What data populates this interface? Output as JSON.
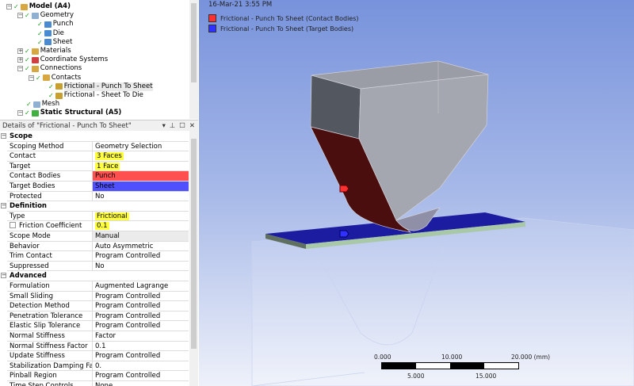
{
  "tree": {
    "items": [
      {
        "label": "Model (A4)",
        "bold": true,
        "level": 0,
        "exp": "−"
      },
      {
        "label": "Geometry",
        "level": 1,
        "exp": "−"
      },
      {
        "label": "Punch",
        "level": 2
      },
      {
        "label": "Die",
        "level": 2
      },
      {
        "label": "Sheet",
        "level": 2
      },
      {
        "label": "Materials",
        "level": 1,
        "exp": "+"
      },
      {
        "label": "Coordinate Systems",
        "level": 1,
        "exp": "+"
      },
      {
        "label": "Connections",
        "level": 1,
        "exp": "−"
      },
      {
        "label": "Contacts",
        "level": 2,
        "exp": "−"
      },
      {
        "label": "Frictional - Punch To Sheet",
        "level": 3,
        "selected": true
      },
      {
        "label": "Frictional - Sheet To Die",
        "level": 3
      },
      {
        "label": "Mesh",
        "level": 1
      },
      {
        "label": "Static Structural (A5)",
        "bold": true,
        "level": 1,
        "exp": "−"
      }
    ]
  },
  "details": {
    "title": "Details of \"Frictional - Punch To Sheet\"",
    "rows": [
      {
        "group": "Scope"
      },
      {
        "k": "Scoping Method",
        "v": "Geometry Selection"
      },
      {
        "k": "Contact",
        "v": "3 Faces",
        "hl": true
      },
      {
        "k": "Target",
        "v": "1 Face",
        "hl": true
      },
      {
        "k": "Contact Bodies",
        "v": "Punch",
        "bg": "#ff5050"
      },
      {
        "k": "Target Bodies",
        "v": "Sheet",
        "bg": "#5050ff"
      },
      {
        "k": "Protected",
        "v": "No"
      },
      {
        "group": "Definition"
      },
      {
        "k": "Type",
        "v": "Frictional",
        "hl": true
      },
      {
        "k": "Friction Coefficient",
        "v": "0.1",
        "hl": true,
        "checkbox": true
      },
      {
        "k": "Scope Mode",
        "v": "Manual",
        "bg": "#ebebeb"
      },
      {
        "k": "Behavior",
        "v": "Auto Asymmetric"
      },
      {
        "k": "Trim Contact",
        "v": "Program Controlled"
      },
      {
        "k": "Suppressed",
        "v": "No"
      },
      {
        "group": "Advanced"
      },
      {
        "k": "Formulation",
        "v": "Augmented Lagrange"
      },
      {
        "k": "Small Sliding",
        "v": "Program Controlled"
      },
      {
        "k": "Detection Method",
        "v": "Program Controlled"
      },
      {
        "k": "Penetration Tolerance",
        "v": "Program Controlled"
      },
      {
        "k": "Elastic Slip Tolerance",
        "v": "Program Controlled"
      },
      {
        "k": "Normal Stiffness",
        "v": "Factor"
      },
      {
        "k": "Normal Stiffness Factor",
        "v": "0.1"
      },
      {
        "k": "Update Stiffness",
        "v": "Program Controlled"
      },
      {
        "k": "Stabilization Damping Factor",
        "v": "0."
      },
      {
        "k": "Pinball Region",
        "v": "Program Controlled"
      },
      {
        "k": "Time Step Controls",
        "v": "None"
      }
    ]
  },
  "viewport": {
    "timestamp": "16-Mar-21 3:55 PM",
    "legend": [
      {
        "label": "Frictional - Punch To Sheet (Contact Bodies)",
        "color": "#ff3030"
      },
      {
        "label": "Frictional - Punch To Sheet (Target Bodies)",
        "color": "#3030ff"
      }
    ],
    "scale": {
      "top": [
        "0.000",
        "10.000",
        "20.000 (mm)"
      ],
      "bottom": [
        "5.000",
        "15.000"
      ]
    }
  }
}
